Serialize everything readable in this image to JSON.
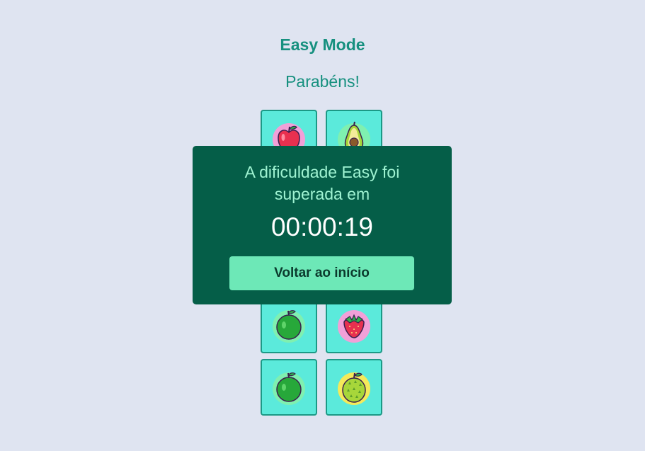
{
  "header": {
    "title": "Easy Mode",
    "subtitle": "Parabéns!"
  },
  "board": {
    "cards": [
      {
        "icon": "apple-icon"
      },
      {
        "icon": "avocado-icon"
      },
      {
        "icon": "hidden"
      },
      {
        "icon": "hidden"
      },
      {
        "icon": "hidden"
      },
      {
        "icon": "hidden"
      },
      {
        "icon": "lime-icon"
      },
      {
        "icon": "strawberry-icon"
      },
      {
        "icon": "lime-icon"
      },
      {
        "icon": "durian-icon"
      }
    ]
  },
  "modal": {
    "message": "A dificuldade Easy foi superada em",
    "time": "00:00:19",
    "button_label": "Voltar ao início"
  },
  "colors": {
    "background": "#dfe4f1",
    "accent": "#16907f",
    "card": "#5beadb",
    "modal": "#055e48",
    "button": "#6de8b7"
  }
}
